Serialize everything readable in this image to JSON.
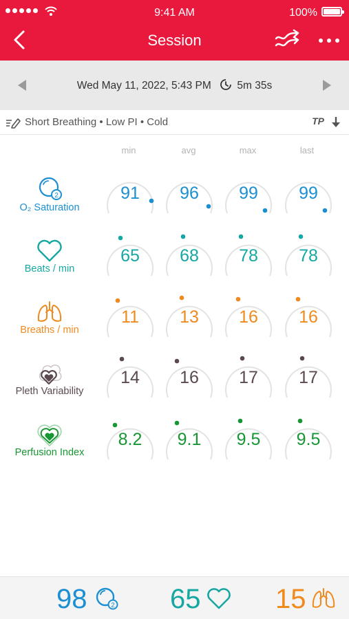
{
  "status_bar": {
    "time": "9:41 AM",
    "battery": "100%"
  },
  "header": {
    "title": "Session"
  },
  "session": {
    "date": "Wed May 11, 2022, 5:43 PM",
    "duration": "5m 35s"
  },
  "notes": {
    "tags": "Short Breathing • Low PI • Cold",
    "tp_label": "TP"
  },
  "columns": [
    "min",
    "avg",
    "max",
    "last"
  ],
  "metrics": [
    {
      "label": "O₂ Saturation",
      "icon": "o2-saturation-icon",
      "color": "#1b8fd2",
      "values": [
        "91",
        "96",
        "99",
        "99"
      ]
    },
    {
      "label": "Beats / min",
      "icon": "heart-icon",
      "color": "#17a7a3",
      "values": [
        "65",
        "68",
        "78",
        "78"
      ]
    },
    {
      "label": "Breaths / min",
      "icon": "lungs-icon",
      "color": "#ef8a1f",
      "values": [
        "11",
        "13",
        "16",
        "16"
      ]
    },
    {
      "label": "Pleth Variability",
      "icon": "pleth-variability-icon",
      "color": "#5a4a4f",
      "values": [
        "14",
        "16",
        "17",
        "17"
      ]
    },
    {
      "label": "Perfusion Index",
      "icon": "perfusion-index-icon",
      "color": "#179633",
      "values": [
        "8.2",
        "9.1",
        "9.5",
        "9.5"
      ]
    }
  ],
  "live": {
    "spo2": "98",
    "pulse": "65",
    "resp": "15"
  },
  "colors": {
    "brand_red": "#e8193c",
    "spo2": "#1b8fd2",
    "pulse": "#17a7a3",
    "resp": "#ef8a1f",
    "pvi": "#5a4a4f",
    "pi": "#179633"
  }
}
